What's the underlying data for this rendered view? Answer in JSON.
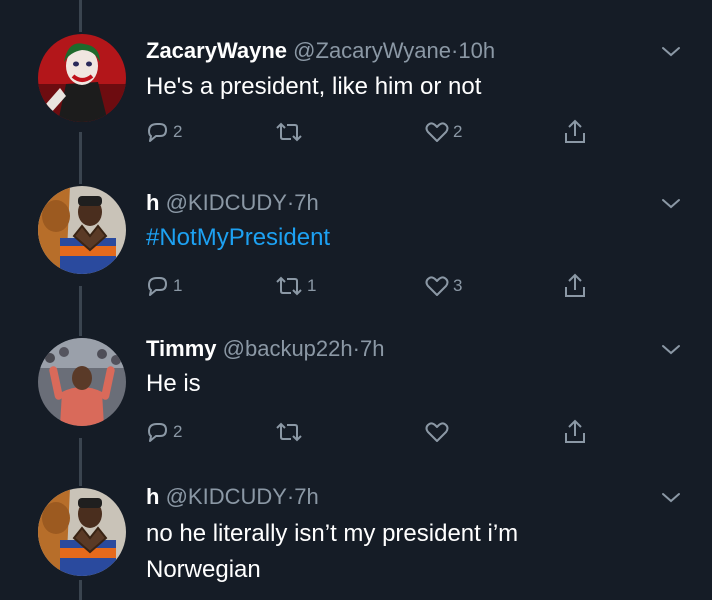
{
  "colors": {
    "background": "#151c26",
    "text_primary": "#ffffff",
    "text_secondary": "#8b98a5",
    "link": "#1da1f2",
    "thread_line": "#3a444f"
  },
  "tweets": [
    {
      "name": "ZacaryWayne",
      "handle": "@ZacaryWyane",
      "separator": "·",
      "time": "10h",
      "text": "He's a president, like him or not",
      "hashtag": "",
      "replies": "2",
      "retweets": "",
      "likes": "2",
      "avatar_icon": "joker-avatar"
    },
    {
      "name": "h",
      "handle": "@KIDCUDY",
      "separator": "·",
      "time": "7h",
      "text": "",
      "hashtag": "#NotMyPresident",
      "replies": "1",
      "retweets": "1",
      "likes": "3",
      "avatar_icon": "heart-hands-avatar"
    },
    {
      "name": "Timmy",
      "handle": "@backup22h",
      "separator": "·",
      "time": "7h",
      "text": "He is",
      "hashtag": "",
      "replies": "2",
      "retweets": "",
      "likes": "",
      "avatar_icon": "crowd-avatar"
    },
    {
      "name": "h",
      "handle": "@KIDCUDY",
      "separator": "·",
      "time": "7h",
      "text_line1": "no he literally isn’t my president i’m",
      "text_line2": "Norwegian",
      "avatar_icon": "heart-hands-avatar"
    }
  ],
  "icons": {
    "reply": "reply-icon",
    "retweet": "retweet-icon",
    "like": "like-icon",
    "share": "share-icon",
    "more": "chevron-down-icon"
  }
}
